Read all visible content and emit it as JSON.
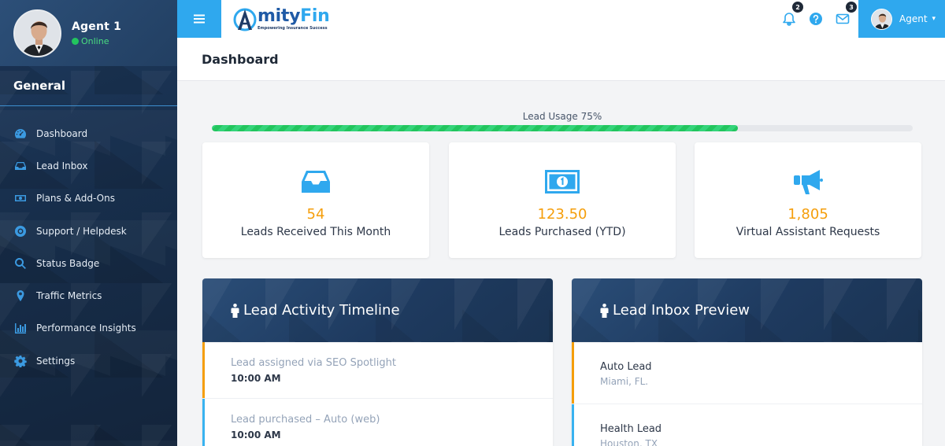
{
  "profile": {
    "name": "Agent 1",
    "status": "Online"
  },
  "sidebar": {
    "section_title": "General",
    "items": [
      {
        "label": "Dashboard",
        "icon": "dashboard-icon"
      },
      {
        "label": "Lead Inbox",
        "icon": "inbox-icon"
      },
      {
        "label": "Plans & Add-Ons",
        "icon": "money-icon"
      },
      {
        "label": "Support / Helpdesk",
        "icon": "lifebuoy-icon"
      },
      {
        "label": "Status Badge",
        "icon": "search-icon"
      },
      {
        "label": "Traffic Metrics",
        "icon": "map-pin-icon"
      },
      {
        "label": "Performance Insights",
        "icon": "bar-chart-icon"
      },
      {
        "label": "Settings",
        "icon": "gear-icon"
      }
    ]
  },
  "topbar": {
    "logo_name_a": "mity",
    "logo_name_b": "Fin",
    "logo_tagline": "Empowering Insurance Success",
    "notifications_count": "2",
    "messages_count": "3",
    "user_label": "Agent"
  },
  "page": {
    "title": "Dashboard"
  },
  "usage": {
    "label": "Lead Usage 75%",
    "percent": 0.75
  },
  "stats": [
    {
      "value": "54",
      "label": "Leads Received This Month",
      "icon": "inbox-tray-icon"
    },
    {
      "value": "123.50",
      "label": "Leads Purchased (YTD)",
      "icon": "money-bill-icon"
    },
    {
      "value": "1,805",
      "label": "Virtual Assistant Requests",
      "icon": "megaphone-icon"
    }
  ],
  "timeline": {
    "title": "Lead Activity Timeline",
    "items": [
      {
        "desc": "Lead assigned via SEO Spotlight",
        "time": "10:00 AM"
      },
      {
        "desc": "Lead purchased – Auto (web)",
        "time": "10:00 AM"
      }
    ]
  },
  "inbox_preview": {
    "title": "Lead Inbox Preview",
    "items": [
      {
        "title": "Auto Lead",
        "location": "Miami, FL."
      },
      {
        "title": "Health Lead",
        "location": "Houston, TX"
      }
    ]
  },
  "colors": {
    "accent": "#2fa8ee",
    "sidebar": "#1e3a5f",
    "stat_value": "#f59e0b",
    "progress": "#22c55e"
  }
}
